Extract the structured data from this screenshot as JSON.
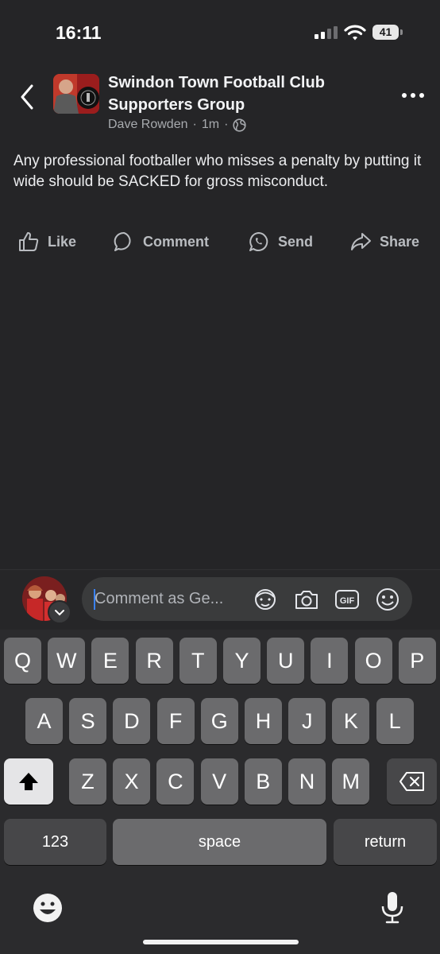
{
  "status_bar": {
    "time": "16:11",
    "battery": "41"
  },
  "post": {
    "group_name_line1": "Swindon Town Football Club",
    "group_name_line2": "Supporters Group",
    "author": "Dave Rowden",
    "time_ago": "1m",
    "text": "Any professional footballer who misses a penalty by putting it wide should be SACKED for gross misconduct."
  },
  "actions": {
    "like": "Like",
    "comment": "Comment",
    "send": "Send",
    "share": "Share"
  },
  "comment_bar": {
    "placeholder": "Comment as Ge..."
  },
  "keyboard": {
    "row1": [
      "Q",
      "W",
      "E",
      "R",
      "T",
      "Y",
      "U",
      "I",
      "O",
      "P"
    ],
    "row2": [
      "A",
      "S",
      "D",
      "F",
      "G",
      "H",
      "J",
      "K",
      "L"
    ],
    "row3": [
      "Z",
      "X",
      "C",
      "V",
      "B",
      "N",
      "M"
    ],
    "numbers": "123",
    "space": "space",
    "return": "return"
  },
  "colors": {
    "background": "#252527",
    "accent_caret": "#3b82f6"
  }
}
